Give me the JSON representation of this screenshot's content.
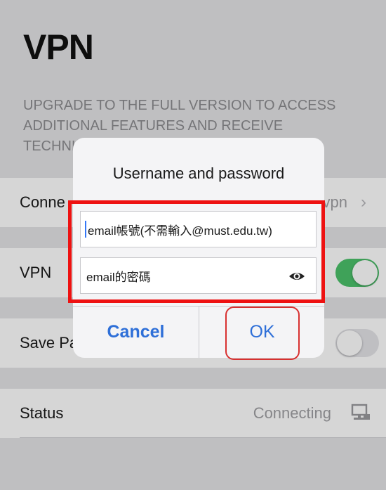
{
  "page": {
    "title": "VPN",
    "promo_text": "UPGRADE TO THE FULL VERSION TO ACCESS ADDITIONAL FEATURES AND RECEIVE TECHNICAL SUPPORT"
  },
  "rows": {
    "connection": {
      "label": "Conne",
      "value": "vpn",
      "chevron": "›"
    },
    "vpn": {
      "label": "VPN",
      "toggle_on": true
    },
    "save_password": {
      "label": "Save Pa",
      "toggle_on": false
    },
    "status": {
      "label": "Status",
      "value": "Connecting",
      "icon": "network-computer-icon"
    }
  },
  "dialog": {
    "title": "Username and password",
    "username_placeholder": "email帳號(不需輸入@must.edu.tw)",
    "password_placeholder": "email的密碼",
    "cancel_label": "Cancel",
    "ok_label": "OK"
  },
  "colors": {
    "accent": "#2e6fd8",
    "toggle_on": "#4cc16b",
    "highlight": "#ee1111"
  }
}
